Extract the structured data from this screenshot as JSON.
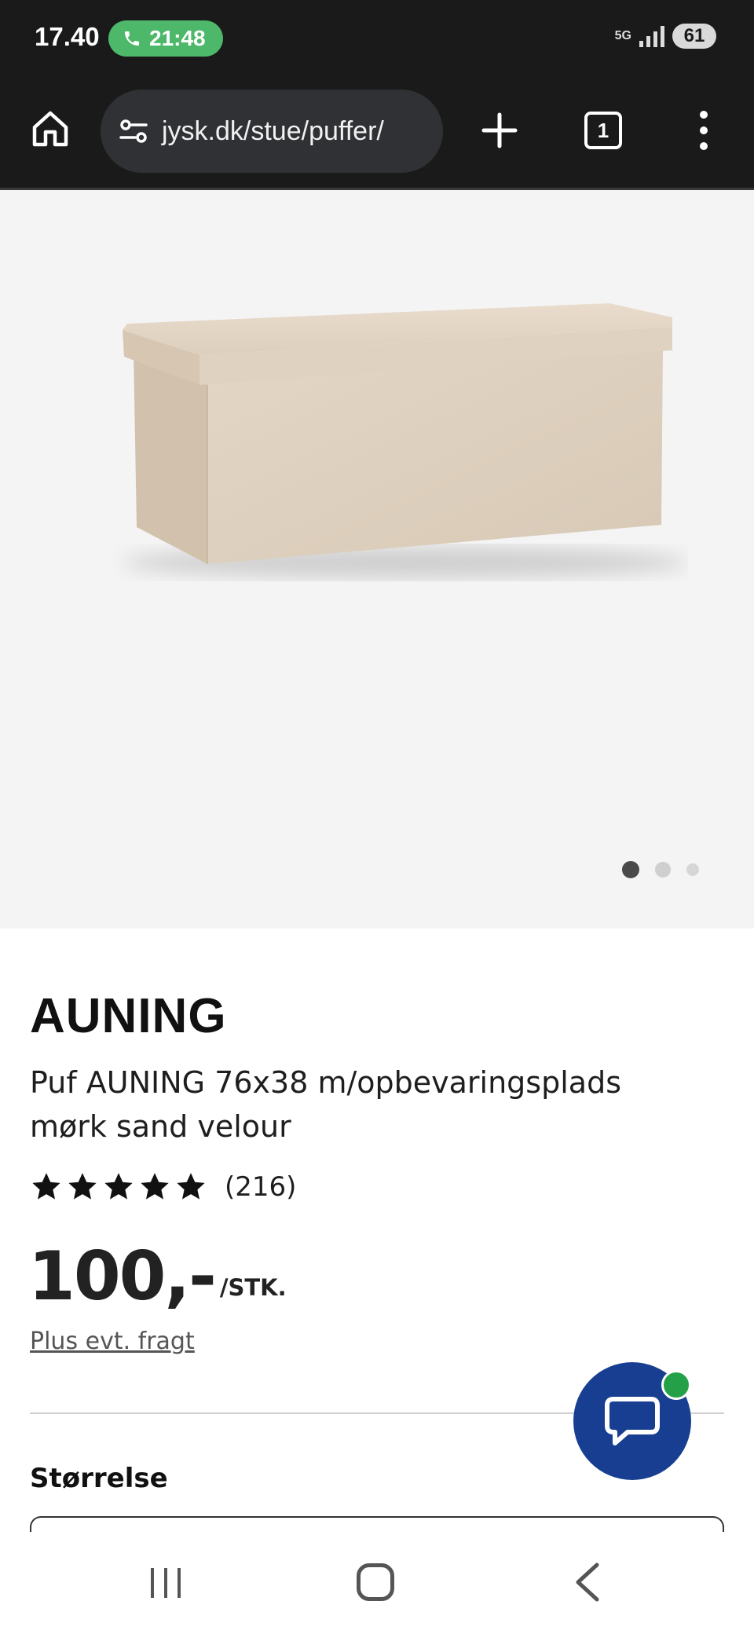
{
  "status_bar": {
    "time": "17.40",
    "call_timer": "21:48",
    "network": "5G",
    "battery": "61"
  },
  "browser": {
    "url": "jysk.dk/stue/puffer/",
    "tab_count": "1"
  },
  "gallery": {
    "image_alt": "product-photo",
    "dot_count": 3,
    "active_dot": 0
  },
  "product": {
    "brand": "AUNING",
    "name": "Puf AUNING 76x38 m/opbevaringsplads mørk sand velour",
    "rating_stars": 5,
    "review_count": "(216)",
    "price": "100,-",
    "price_unit": "/STK.",
    "shipping_note": "Plus evt. fragt",
    "size_label": "Størrelse"
  },
  "colors": {
    "chrome_dark": "#1a1a1a",
    "call_green": "#4db86a",
    "chat_blue": "#173e91",
    "online_green": "#24a148",
    "gallery_bg": "#f4f4f4"
  }
}
